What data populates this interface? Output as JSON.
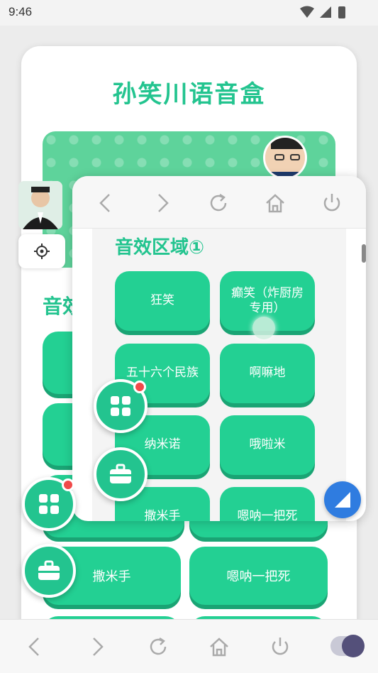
{
  "status_bar": {
    "time": "9:46"
  },
  "app": {
    "title": "孙笑川语音盒",
    "section_title_partial": "音效",
    "buttons_behind": [
      {
        "label": "撒米手"
      },
      {
        "label": "嗯呐一把死"
      }
    ]
  },
  "overlay": {
    "section_title": "音效区域①",
    "buttons": [
      {
        "label": "狂笑"
      },
      {
        "label": "癫笑（炸厨房专用）"
      },
      {
        "label": "五十六个民族"
      },
      {
        "label": "啊嘛地"
      },
      {
        "label": "纳米诺"
      },
      {
        "label": "哦啦米"
      },
      {
        "label": "撒米手"
      },
      {
        "label": "嗯呐一把死"
      }
    ]
  },
  "colors": {
    "accent": "#23c48f",
    "button": "#23d093",
    "badge": "#f04a4a",
    "blue_fab": "#2f7ce0"
  },
  "icons": [
    "back-icon",
    "forward-icon",
    "refresh-icon",
    "home-icon",
    "power-icon",
    "settings-icon",
    "grid-icon",
    "toolbox-icon"
  ]
}
